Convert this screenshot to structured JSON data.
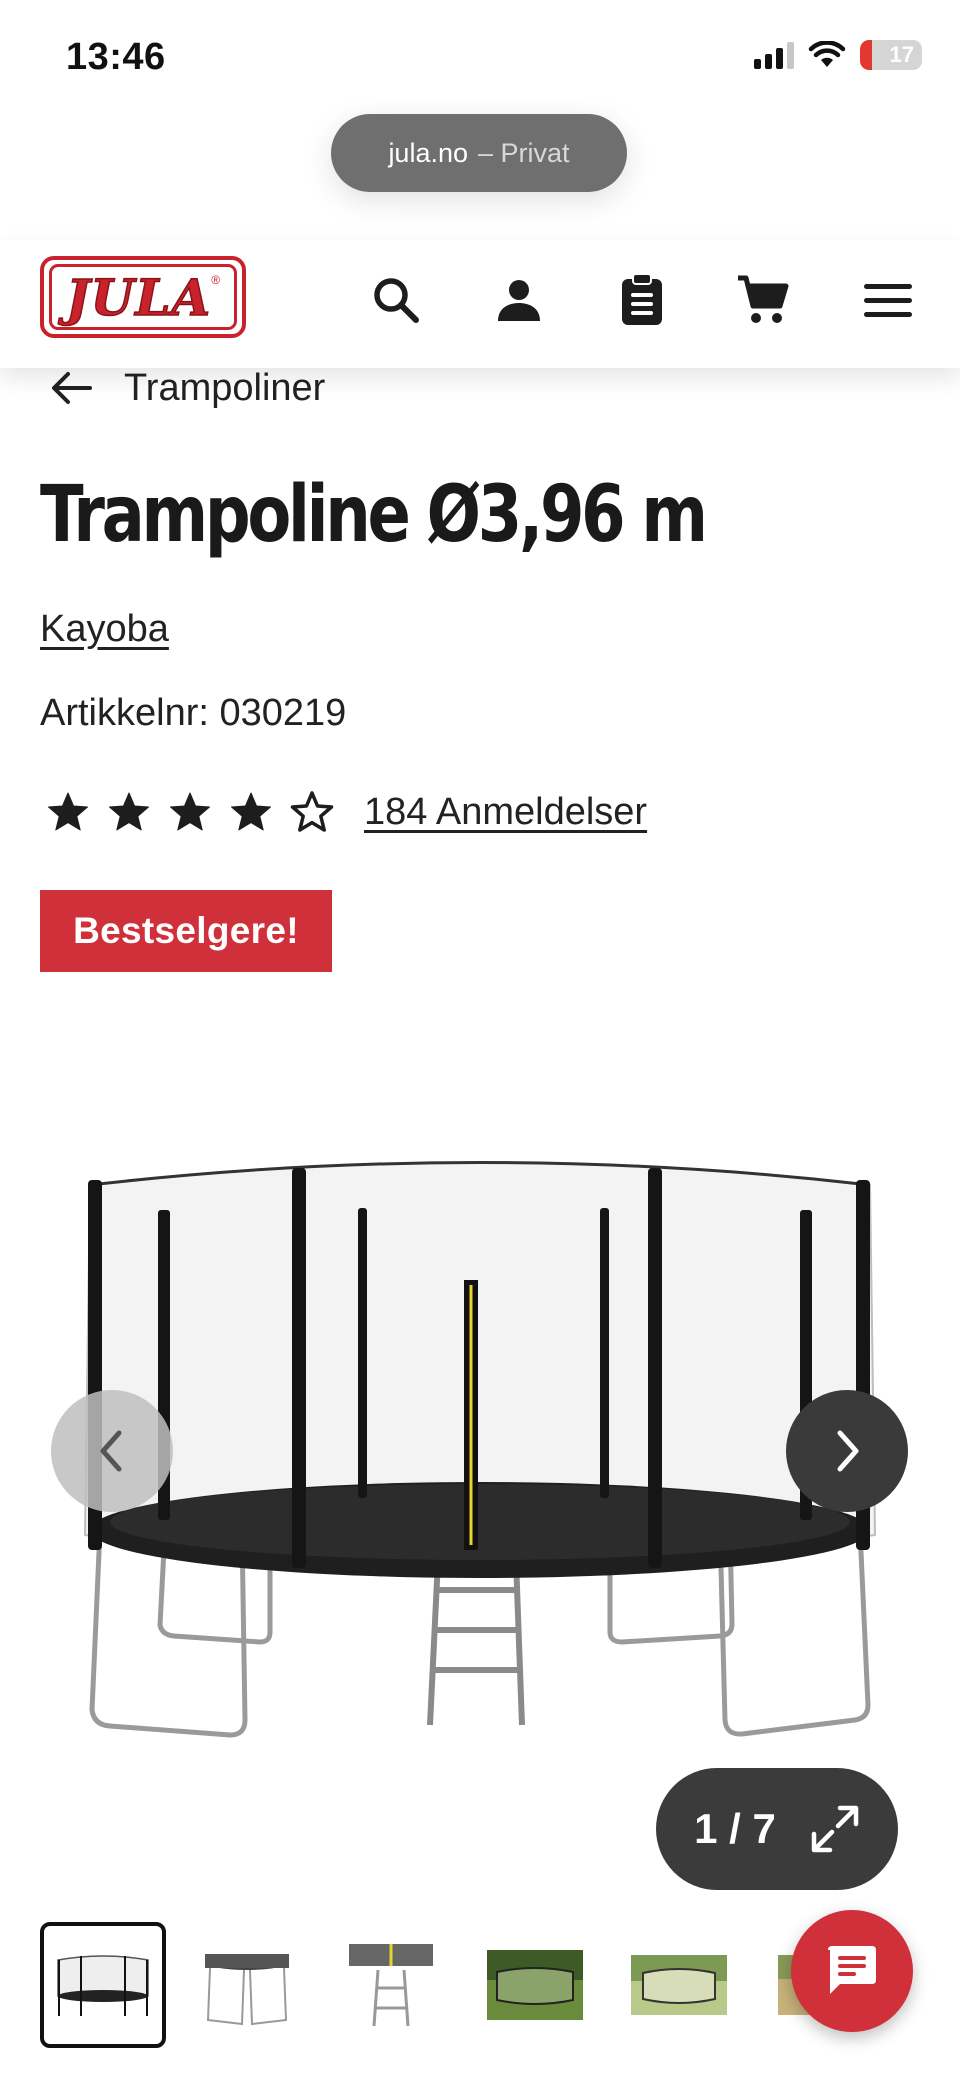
{
  "status_bar": {
    "time": "13:46",
    "battery": "17",
    "icons": [
      "signal-icon",
      "wifi-icon",
      "battery-icon"
    ]
  },
  "browser": {
    "domain": "jula.no",
    "mode": "– Privat"
  },
  "header": {
    "logo_text": "JULA",
    "logo_mark": "®",
    "icons": [
      "search-icon",
      "account-icon",
      "shopping-list-icon",
      "cart-icon",
      "menu-icon"
    ]
  },
  "breadcrumb": {
    "back_label": "Trampoliner"
  },
  "product": {
    "title": "Trampoline Ø3,96 m",
    "brand": "Kayoba",
    "article_number": "Artikkelnr: 030219",
    "rating": 4,
    "rating_max": 5,
    "reviews_label": "184 Anmeldelser",
    "badge": "Bestselgere!"
  },
  "gallery": {
    "counter": "1 / 7",
    "current": 1,
    "total": 7
  },
  "colors": {
    "brand_red": "#d0303a",
    "text": "#1d1d1d",
    "dark_pill": "#3b3b3b"
  }
}
